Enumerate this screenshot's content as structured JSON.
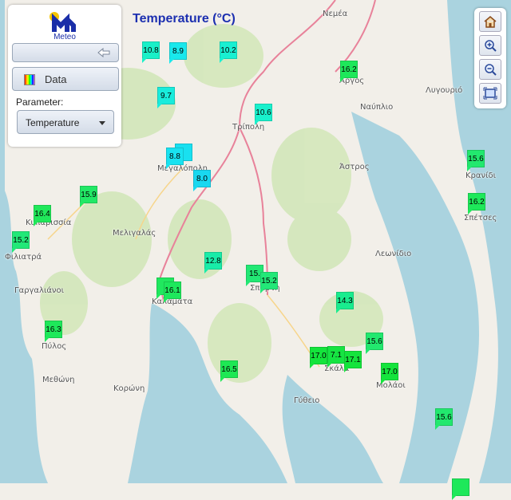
{
  "title": "Temperature (°C)",
  "panel": {
    "logo_text": "Meteo",
    "data_label": "Data",
    "parameter_label": "Parameter:",
    "parameter_value": "Temperature"
  },
  "toolbar": {
    "icons": [
      "home-icon",
      "zoom-in-icon",
      "zoom-out-icon",
      "extent-icon"
    ]
  },
  "places": [
    {
      "name": "Νεμέα"
    },
    {
      "name": "Άργος"
    },
    {
      "name": "Ναύπλιο"
    },
    {
      "name": "Λυγουριό"
    },
    {
      "name": "Τρίπολη"
    },
    {
      "name": "Άστρος"
    },
    {
      "name": "Κρανίδι"
    },
    {
      "name": "Σπέτσες"
    },
    {
      "name": "Μεγαλόπολη"
    },
    {
      "name": "Κυπαρισσία"
    },
    {
      "name": "Μελιγαλάς"
    },
    {
      "name": "Φιλιατρά"
    },
    {
      "name": "Λεωνίδιο"
    },
    {
      "name": "Γαργαλιάνοι"
    },
    {
      "name": "Καλαμάτα"
    },
    {
      "name": "Σπάρτη"
    },
    {
      "name": "Πύλος"
    },
    {
      "name": "Μεθώνη"
    },
    {
      "name": "Κορώνη"
    },
    {
      "name": "Σκάλα"
    },
    {
      "name": "Μολάοι"
    },
    {
      "name": "Γύθειο"
    }
  ],
  "stations": [
    {
      "value": "10.8",
      "color": "#19f0c8"
    },
    {
      "value": "8.9",
      "color": "#19e8ec"
    },
    {
      "value": "10.2",
      "color": "#19f0d2"
    },
    {
      "value": "16.2",
      "color": "#1ee85a"
    },
    {
      "value": "9.7",
      "color": "#19ecdc"
    },
    {
      "value": "10.6",
      "color": "#19f0cc"
    },
    {
      "value": "",
      "color": "#19e0f0"
    },
    {
      "value": "8.8",
      "color": "#19e2f0"
    },
    {
      "value": "8.0",
      "color": "#19d8f0"
    },
    {
      "value": "15.9",
      "color": "#22e866"
    },
    {
      "value": "15.6",
      "color": "#22e86e"
    },
    {
      "value": "16.4",
      "color": "#20e85a"
    },
    {
      "value": "16.2",
      "color": "#1ee85a"
    },
    {
      "value": "15.2",
      "color": "#22e878"
    },
    {
      "value": "12.8",
      "color": "#19eca8"
    },
    {
      "value": "15.",
      "color": "#22e874"
    },
    {
      "value": "15.2",
      "color": "#22e878"
    },
    {
      "value": "1",
      "color": "#20e85e"
    },
    {
      "value": "16.1",
      "color": "#1ee85c"
    },
    {
      "value": "14.3",
      "color": "#19ec8e"
    },
    {
      "value": "16.3",
      "color": "#1ee85a"
    },
    {
      "value": "15.6",
      "color": "#22e86e"
    },
    {
      "value": "17.0",
      "color": "#14e43c"
    },
    {
      "value": "7.1",
      "color": "#16e442"
    },
    {
      "value": "17.1",
      "color": "#14e43c"
    },
    {
      "value": "17.0",
      "color": "#14e43c"
    },
    {
      "value": "16.5",
      "color": "#1ee854"
    },
    {
      "value": "15.6",
      "color": "#22e86e"
    },
    {
      "value": "",
      "color": "#1ee85a"
    }
  ]
}
